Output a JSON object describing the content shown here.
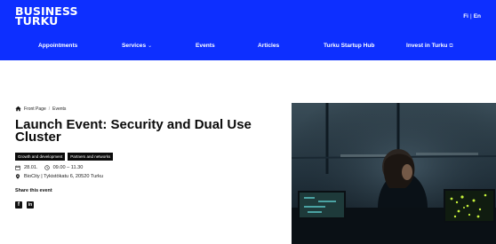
{
  "header": {
    "logo_line1": "BUSINESS",
    "logo_line2": "TURKU",
    "lang_fi": "Fi",
    "lang_en": "En",
    "lang_sep": "|"
  },
  "nav": {
    "appointments": "Appointments",
    "services": "Services",
    "events": "Events",
    "articles": "Articles",
    "startup_hub": "Turku Startup Hub",
    "invest": "Invest in Turku"
  },
  "breadcrumb": {
    "front_page": "Front Page",
    "separator": "/",
    "events": "Events"
  },
  "event": {
    "title": "Launch Event: Security and Dual Use Cluster",
    "tags": [
      "Growth and development",
      "Partners and networks"
    ],
    "date": "28.01.",
    "time": "09.00 – 11.30",
    "location": "BioCity | Tykistökatu 6, 20520 Turku",
    "share_label": "Share this event"
  },
  "colors": {
    "brand_blue": "#0d2fff",
    "text_dark": "#0b0b0b"
  },
  "icons": {
    "home": "home-icon",
    "calendar": "calendar-icon",
    "clock": "clock-icon",
    "location": "location-pin-icon",
    "facebook": "facebook-icon",
    "linkedin": "linkedin-icon",
    "caret": "chevron-down-icon",
    "external": "external-link-icon"
  },
  "hero_image": {
    "subject": "control-room-photo"
  }
}
